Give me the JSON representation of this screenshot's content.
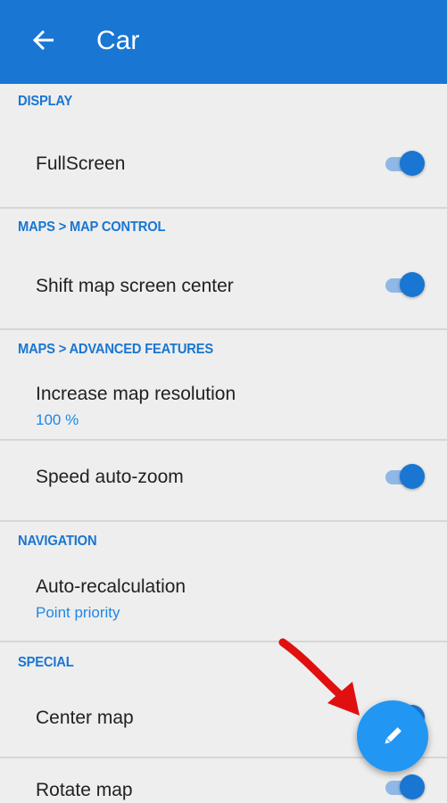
{
  "header": {
    "title": "Car",
    "back_icon": "arrow-back-icon",
    "background_color": "#1976d2"
  },
  "sections": [
    {
      "header": "DISPLAY",
      "items": [
        {
          "title": "FullScreen",
          "toggle": true
        }
      ]
    },
    {
      "header": "MAPS > MAP CONTROL",
      "items": [
        {
          "title": "Shift map screen center",
          "toggle": true
        }
      ]
    },
    {
      "header": "MAPS > ADVANCED FEATURES",
      "items": [
        {
          "title": "Increase map resolution",
          "subtitle": "100 %"
        },
        {
          "title": "Speed auto-zoom",
          "toggle": true
        }
      ]
    },
    {
      "header": "NAVIGATION",
      "items": [
        {
          "title": "Auto-recalculation",
          "subtitle": "Point priority"
        }
      ]
    },
    {
      "header": "SPECIAL",
      "items": [
        {
          "title": "Center map",
          "toggle": true
        },
        {
          "title": "Rotate map",
          "toggle": true
        }
      ]
    }
  ],
  "fab": {
    "icon": "pencil-icon",
    "color": "#2196f3"
  },
  "annotation": {
    "icon": "red-arrow-icon",
    "color": "#e01010"
  },
  "accent_color": "#1976d2"
}
